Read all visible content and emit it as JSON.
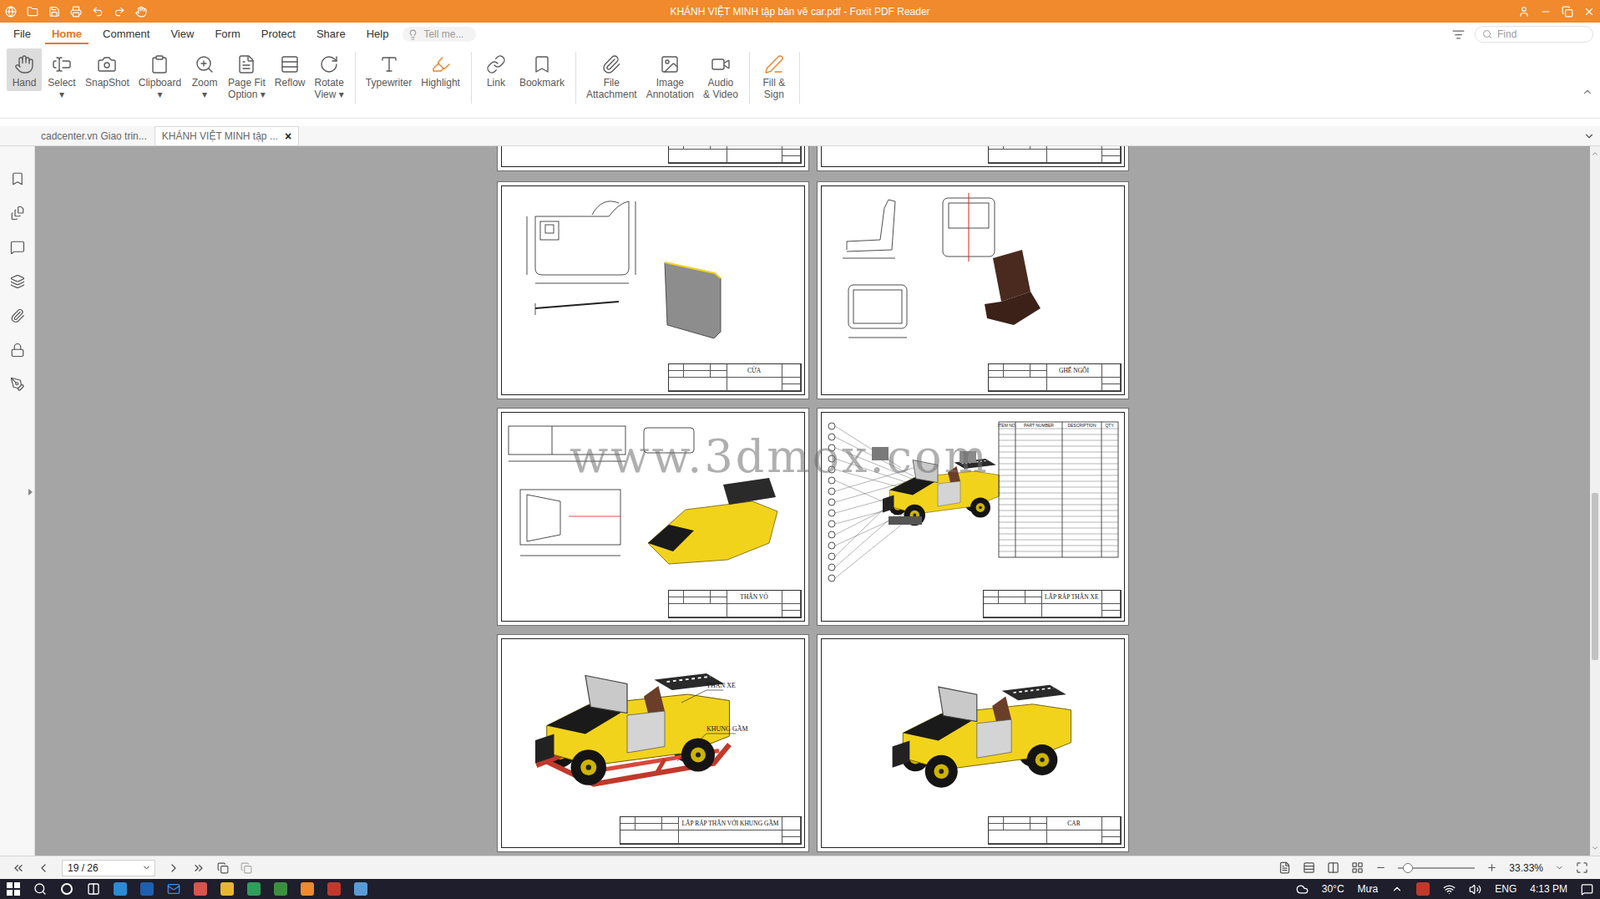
{
  "window": {
    "title": "KHÁNH VIỆT MINH tập bản vẽ car.pdf - Foxit PDF Reader"
  },
  "menu": [
    {
      "label": "File",
      "selected": false
    },
    {
      "label": "Home",
      "selected": true
    },
    {
      "label": "Comment",
      "selected": false
    },
    {
      "label": "View",
      "selected": false
    },
    {
      "label": "Form",
      "selected": false
    },
    {
      "label": "Protect",
      "selected": false
    },
    {
      "label": "Share",
      "selected": false
    },
    {
      "label": "Help",
      "selected": false
    }
  ],
  "tell_me": {
    "placeholder": "Tell me..."
  },
  "find": {
    "placeholder": "Find"
  },
  "ribbon": [
    {
      "lines": [
        "Hand"
      ],
      "selected": true,
      "group": 1
    },
    {
      "lines": [
        "Select",
        "▾"
      ],
      "selected": false,
      "group": 1
    },
    {
      "lines": [
        "SnapShot"
      ],
      "selected": false,
      "group": 1
    },
    {
      "lines": [
        "Clipboard",
        "▾"
      ],
      "selected": false,
      "group": 1
    },
    {
      "lines": [
        "Zoom",
        "▾"
      ],
      "selected": false,
      "group": 1
    },
    {
      "lines": [
        "Page Fit",
        "Option ▾"
      ],
      "selected": false,
      "group": 1
    },
    {
      "lines": [
        "Reflow"
      ],
      "selected": false,
      "group": 1
    },
    {
      "lines": [
        "Rotate",
        "View ▾"
      ],
      "selected": false,
      "group": 1
    },
    {
      "lines": [
        "Typewriter"
      ],
      "selected": false,
      "group": 2
    },
    {
      "lines": [
        "Highlight"
      ],
      "selected": false,
      "group": 2
    },
    {
      "lines": [
        "Link"
      ],
      "selected": false,
      "group": 3
    },
    {
      "lines": [
        "Bookmark"
      ],
      "selected": false,
      "group": 3
    },
    {
      "lines": [
        "File",
        "Attachment"
      ],
      "selected": false,
      "group": 4
    },
    {
      "lines": [
        "Image",
        "Annotation"
      ],
      "selected": false,
      "group": 4
    },
    {
      "lines": [
        "Audio",
        "& Video"
      ],
      "selected": false,
      "group": 4
    },
    {
      "lines": [
        "Fill &",
        "Sign"
      ],
      "selected": false,
      "group": 5
    }
  ],
  "doc_tabs": [
    {
      "label": "cadcenter.vn Giao trin...",
      "selected": false,
      "close": ""
    },
    {
      "label": "KHÁNH VIỆT MINH tập ...",
      "selected": true,
      "close": "×"
    }
  ],
  "pages": [
    {
      "kind": "stub",
      "title": ""
    },
    {
      "kind": "stub",
      "title": ""
    },
    {
      "kind": "door",
      "title": "CỬA"
    },
    {
      "kind": "seat",
      "title": "GHẾ NGỒI"
    },
    {
      "kind": "body",
      "title": "THÂN VỎ"
    },
    {
      "kind": "exploded",
      "title": "LẮP RÁP THÂN XE",
      "bom_columns": [
        "ITEM NO.",
        "PART NUMBER",
        "DESCRIPTION",
        "QTY."
      ]
    },
    {
      "kind": "chassis",
      "title": "LẮP RÁP THÂN VỚI KHUNG GẦM",
      "callouts": [
        "THÂN XE",
        "KHUNG GẦM"
      ]
    },
    {
      "kind": "car",
      "title": "CAR"
    }
  ],
  "watermark": "www.3dmox.com",
  "status_bar": {
    "page": "19 / 26",
    "zoom": "33.33%",
    "zoom_level": 0.13
  },
  "taskbar": {
    "temperature": "30°C",
    "weather": "Mưa",
    "language": "ENG",
    "time": "4:13 PM"
  }
}
